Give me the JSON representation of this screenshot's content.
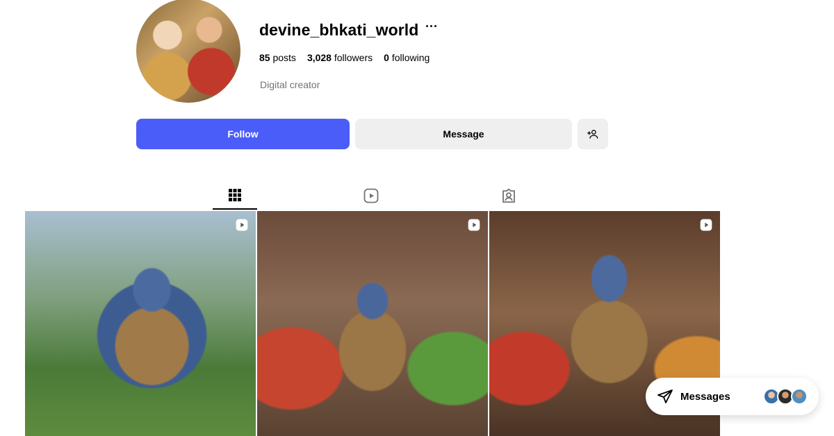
{
  "profile": {
    "username": "devine_bhkati_world",
    "more_glyph": "···",
    "stats": {
      "posts_count": "85",
      "posts_label": "posts",
      "followers_count": "3,028",
      "followers_label": "followers",
      "following_count": "0",
      "following_label": "following"
    },
    "category": "Digital creator"
  },
  "actions": {
    "follow_label": "Follow",
    "message_label": "Message",
    "add_user_glyph": "+👤"
  },
  "tabs": [
    {
      "name": "posts",
      "icon": "grid-icon",
      "active": true
    },
    {
      "name": "reels",
      "icon": "reels-icon",
      "active": false
    },
    {
      "name": "tagged",
      "icon": "tagged-icon",
      "active": false
    }
  ],
  "posts": [
    {
      "type": "reel",
      "icon": "reel-icon"
    },
    {
      "type": "reel",
      "icon": "reel-icon"
    },
    {
      "type": "reel",
      "icon": "reel-icon"
    }
  ],
  "messages": {
    "label": "Messages",
    "icon": "send-icon"
  },
  "colors": {
    "accent": "#4a5df9",
    "button_secondary": "#efefef",
    "muted_text": "#737373"
  }
}
